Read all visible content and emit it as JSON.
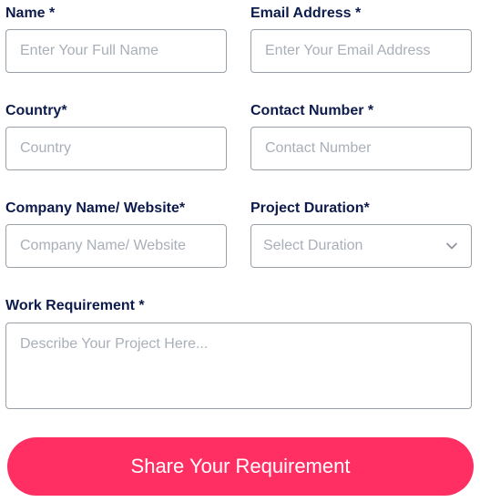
{
  "form": {
    "name": {
      "label": "Name *",
      "placeholder": "Enter Your Full Name"
    },
    "email": {
      "label": "Email Address *",
      "placeholder": "Enter Your Email Address"
    },
    "country": {
      "label": "Country*",
      "placeholder": "Country"
    },
    "contact": {
      "label": "Contact Number *",
      "placeholder": "Contact Number"
    },
    "company": {
      "label": "Company Name/ Website*",
      "placeholder": "Company Name/ Website"
    },
    "duration": {
      "label": "Project Duration*",
      "selected": "Select Duration"
    },
    "requirement": {
      "label": "Work Requirement *",
      "placeholder": "Describe Your Project Here..."
    },
    "submit_label": "Share Your Requirement"
  },
  "colors": {
    "label_text": "#0d1b4c",
    "placeholder": "#a9afb8",
    "border": "#9aa0a8",
    "submit_bg": "#ff2e63",
    "submit_text": "#ffffff"
  },
  "icons": {
    "duration_dropdown": "chevron-down-icon"
  }
}
